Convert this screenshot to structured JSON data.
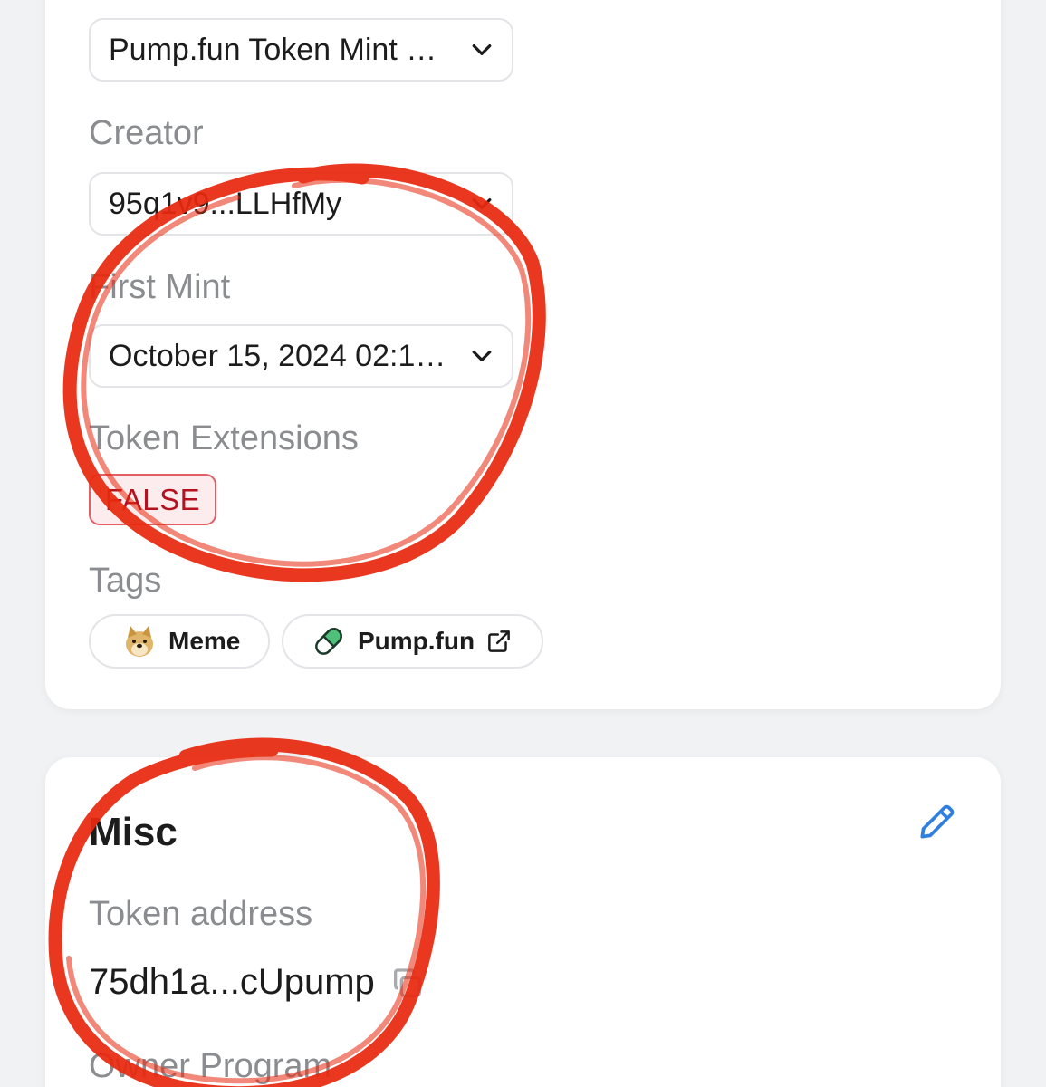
{
  "token_info": {
    "program_dropdown_value": "Pump.fun Token Mint …",
    "creator": {
      "label": "Creator",
      "value": "95q1v9...LLHfMy"
    },
    "first_mint": {
      "label": "First Mint",
      "value": "October 15, 2024 02:1…"
    },
    "token_extensions": {
      "label": "Token Extensions",
      "value": "FALSE"
    },
    "tags": {
      "label": "Tags",
      "items": [
        {
          "label": "Meme",
          "icon": "doge-icon"
        },
        {
          "label": "Pump.fun",
          "icon": "pill-icon",
          "external": "external-link-icon"
        }
      ]
    }
  },
  "misc": {
    "title": "Misc",
    "edit_icon": "pencil-icon",
    "token_address": {
      "label": "Token address",
      "value": "75dh1a...cUpump",
      "copy_icon": "copy-icon"
    },
    "owner_program": {
      "label": "Owner Program"
    }
  },
  "colors": {
    "page_bg": "#f1f2f4",
    "card_bg": "#ffffff",
    "label_gray": "#8a8c90",
    "false_badge_border": "#e06066",
    "false_badge_bg": "#fdecee",
    "false_badge_text": "#b3121e",
    "edit_icon_blue": "#2f7fe0",
    "annotation_red": "#e8290f"
  }
}
